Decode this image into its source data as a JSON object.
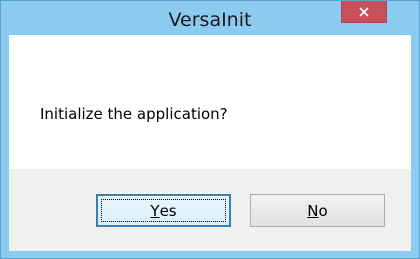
{
  "dialog": {
    "title": "VersaInit",
    "message": "Initialize the application?",
    "buttons": {
      "yes": {
        "accel": "Y",
        "rest": "es"
      },
      "no": {
        "accel": "N",
        "rest": "o"
      }
    },
    "icons": {
      "close": "close-icon"
    },
    "colors": {
      "frame": "#8ccbf0",
      "close_button": "#c7505b",
      "button_area": "#f0f0f0",
      "default_button_border": "#3c7fb1"
    }
  }
}
